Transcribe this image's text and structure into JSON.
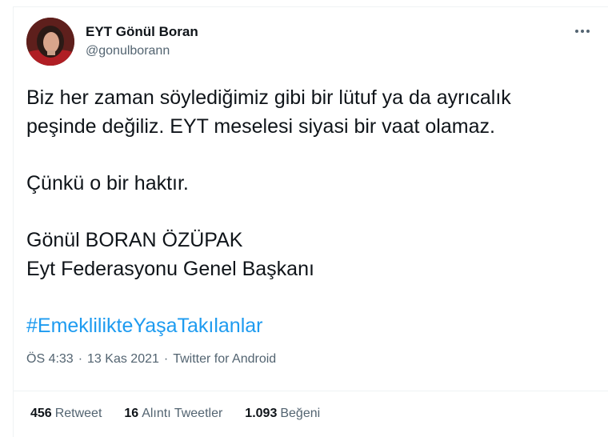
{
  "author": {
    "display_name": "EYT Gönül Boran",
    "handle": "@gonulborann"
  },
  "more_icon": "more-horizontal-icon",
  "tweet": {
    "lines": [
      "Biz her zaman söylediğimiz gibi bir lütuf ya da ayrıcalık",
      "peşinde değiliz. EYT meselesi siyasi bir vaat olamaz.",
      "Çünkü o bir haktır.",
      "Gönül BORAN ÖZÜPAK",
      "Eyt Federasyonu Genel Başkanı"
    ],
    "hashtag": "#EmeklilikteYaşaTakılanlar"
  },
  "meta": {
    "time": "ÖS 4:33",
    "date": "13 Kas 2021",
    "source": "Twitter for Android",
    "separator": "·"
  },
  "stats": {
    "retweets_count": "456",
    "retweets_label": "Retweet",
    "quotes_count": "16",
    "quotes_label": "Alıntı Tweetler",
    "likes_count": "1.093",
    "likes_label": "Beğeni"
  },
  "colors": {
    "link": "#1d9bf0",
    "secondary_text": "#536471",
    "primary_text": "#0f1419",
    "divider": "#eff3f4"
  }
}
